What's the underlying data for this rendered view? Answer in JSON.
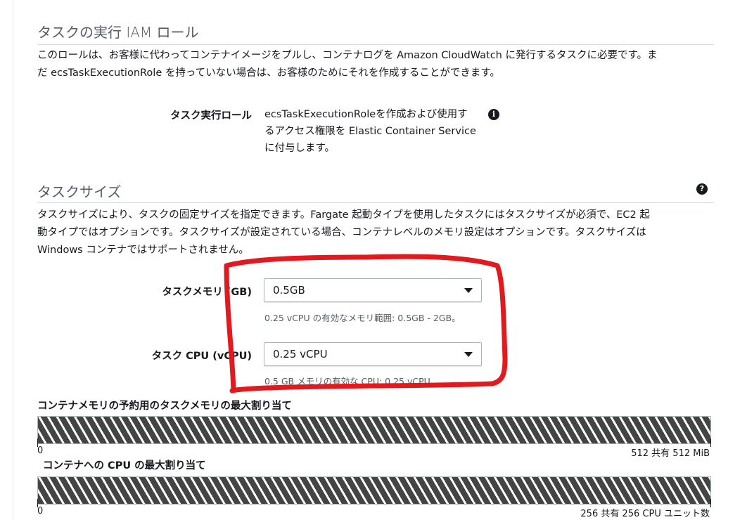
{
  "iam_section": {
    "title": "タスクの実行 IAM ロール",
    "description_line1": "このロールは、お客様に代わってコンテナイメージをプルし、コンテナログを Amazon CloudWatch に発行するタスクに必要です。ま",
    "description_line2": "だ ecsTaskExecutionRole を持っていない場合は、お客様のためにそれを作成することができます。",
    "role_label": "タスク実行ロール",
    "role_text_line1": "ecsTaskExecutionRoleを作成および使用す",
    "role_text_line2": "るアクセス権限を Elastic Container Service",
    "role_text_line3": "に付与します。",
    "info_icon_glyph": "i"
  },
  "task_size_section": {
    "title": "タスクサイズ",
    "help_icon_glyph": "?",
    "description_line1": "タスクサイズにより、タスクの固定サイズを指定できます。Fargate 起動タイプを使用したタスクにはタスクサイズが必須で、EC2 起",
    "description_line2": "動タイプではオプションです。タスクサイズが設定されている場合、コンテナレベルのメモリ設定はオプションです。タスクサイズは",
    "description_line3": "Windows コンテナではサポートされません。",
    "memory_label": "タスクメモリ (GB)",
    "memory_value": "0.5GB",
    "memory_hint": "0.25 vCPU の有効なメモリ範囲: 0.5GB - 2GB。",
    "cpu_label": "タスク CPU (vCPU)",
    "cpu_value": "0.25 vCPU",
    "cpu_hint": "0.5 GB メモリの有効な CPU: 0.25 vCPU"
  },
  "memory_allocation": {
    "title": "コンテナメモリの予約用のタスクメモリの最大割り当て",
    "min_label": "0",
    "max_label": "512 共有 512 MiB",
    "fill_fraction": 1.0
  },
  "cpu_allocation": {
    "title": "コンテナへの CPU の最大割り当て",
    "min_label": "0",
    "max_label": "256 共有 256 CPU ユニット数",
    "fill_fraction": 1.0
  },
  "annotation": {
    "color": "#e3191d"
  },
  "colors": {
    "text": "#16191f",
    "secondary_text": "#545b64",
    "border": "#aab7b8",
    "bar_stripe_dark": "#444444"
  }
}
